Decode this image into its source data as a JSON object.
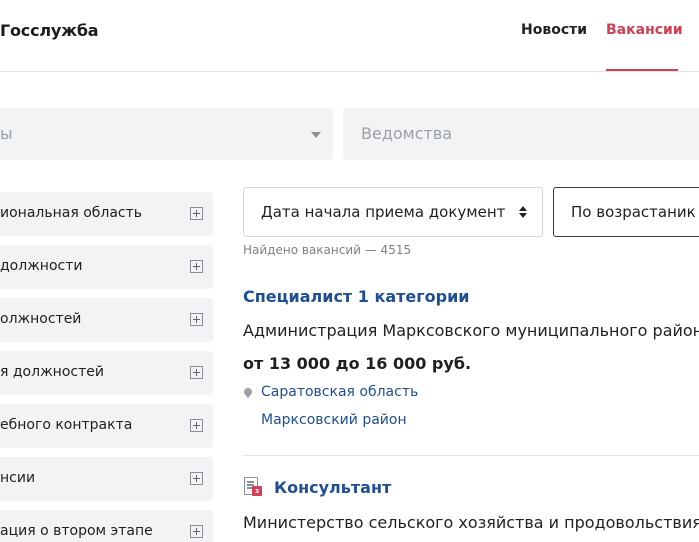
{
  "header": {
    "logo": "Госслужба",
    "nav": [
      {
        "label": "Новости"
      },
      {
        "label": "Вакансии",
        "active": true
      }
    ],
    "accent_color": "#d13f56"
  },
  "filters": {
    "first_placeholder": "ы",
    "second_placeholder": "Ведомства"
  },
  "sidebar": {
    "items": [
      {
        "label": "иональная область"
      },
      {
        "label": "должности"
      },
      {
        "label": "олжностей"
      },
      {
        "label": "я должностей"
      },
      {
        "label": "ебного контракта"
      },
      {
        "label": "нсии"
      },
      {
        "label": "ация о втором этапе"
      }
    ]
  },
  "sort": {
    "field": "Дата начала приема документ",
    "order": "По возрастаник"
  },
  "results": {
    "found_text": "Найдено вакансий — 4515"
  },
  "vacancies": [
    {
      "title": "Специалист 1 категории",
      "org": "Администрация Марксовского муниципального района",
      "salary": "от 13 000 до 16 000 руб.",
      "region": "Саратовская область",
      "district": "Марксовский район"
    },
    {
      "title": "Консультант",
      "org": "Министерство сельского хозяйства и продовольствия",
      "icon": "document-icon",
      "badge": "з"
    }
  ],
  "link_color": "#1f4e91"
}
